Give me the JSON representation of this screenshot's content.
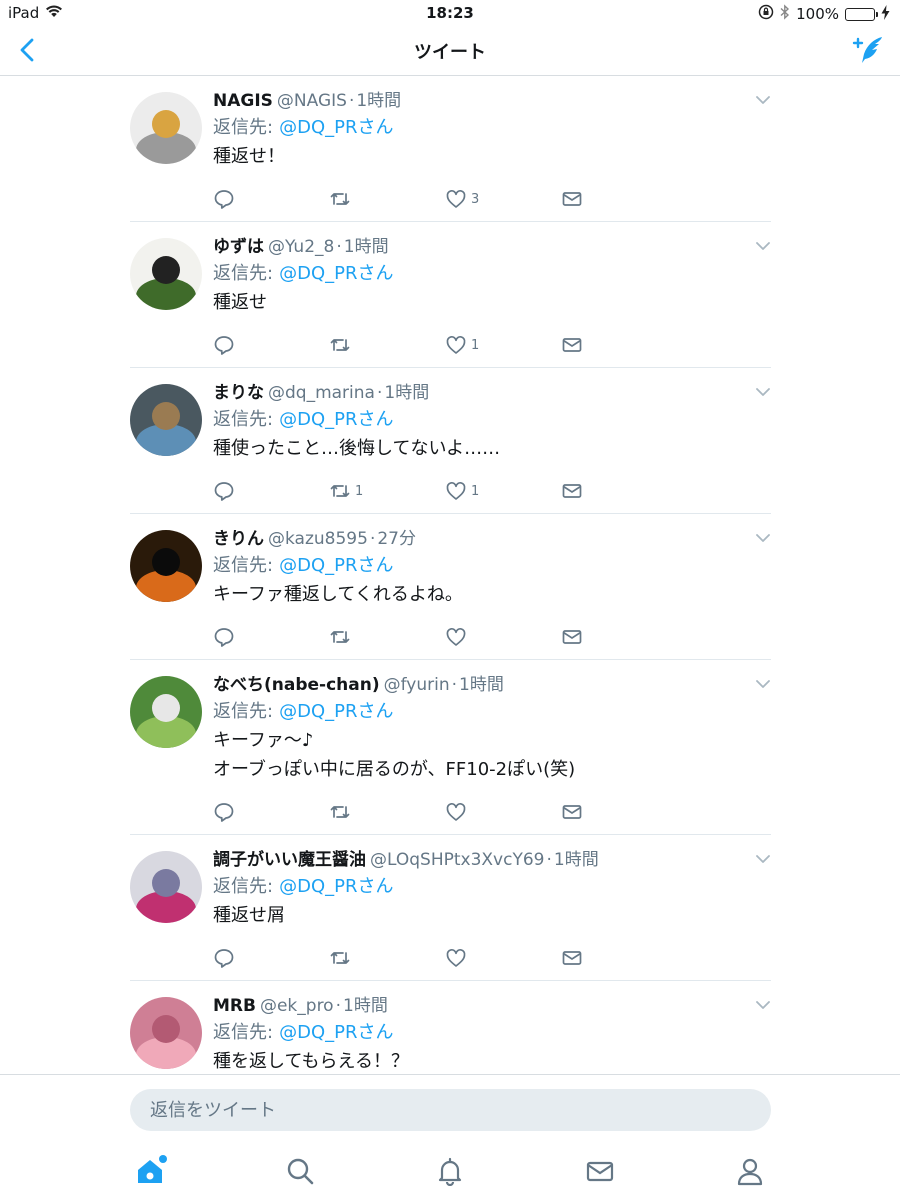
{
  "status_bar": {
    "device": "iPad",
    "time": "18:23",
    "battery": "100%",
    "battery_level": 1.0
  },
  "nav": {
    "title": "ツイート",
    "back_icon": "chevron-left-icon",
    "compose_icon": "compose-tweet-icon"
  },
  "colors": {
    "accent": "#1da1f2",
    "secondary_text": "#657786",
    "divider": "#e1e8ed",
    "input_bg": "#e6ecf0"
  },
  "tweets": [
    {
      "name": "NAGIS",
      "handle": "@NAGIS",
      "dot": "·",
      "time": "1時間",
      "reply_label": "返信先:",
      "reply_mention": "@DQ_PRさん",
      "text": "種返せ！",
      "retweets": "",
      "likes": "3"
    },
    {
      "name": "ゆずは",
      "handle": "@Yu2_8",
      "dot": "·",
      "time": "1時間",
      "reply_label": "返信先:",
      "reply_mention": "@DQ_PRさん",
      "text": "種返せ",
      "retweets": "",
      "likes": "1"
    },
    {
      "name": "まりな",
      "handle": "@dq_marina",
      "dot": "·",
      "time": "1時間",
      "reply_label": "返信先:",
      "reply_mention": "@DQ_PRさん",
      "text": "種使ったこと…後悔してないよ……",
      "retweets": "1",
      "likes": "1"
    },
    {
      "name": "きりん",
      "handle": "@kazu8595",
      "dot": "·",
      "time": "27分",
      "reply_label": "返信先:",
      "reply_mention": "@DQ_PRさん",
      "text": "キーファ種返してくれるよね。",
      "retweets": "",
      "likes": ""
    },
    {
      "name": "なべち(nabe-chan)",
      "handle": "@fyurin",
      "dot": "·",
      "time": "1時間",
      "reply_label": "返信先:",
      "reply_mention": "@DQ_PRさん",
      "text": "キーファ～♪\nオーブっぽい中に居るのが、FF10-2ぽい(笑)",
      "retweets": "",
      "likes": ""
    },
    {
      "name": "調子がいい魔王醤油",
      "handle": "@LOqSHPtx3XvcY69",
      "dot": "·",
      "time": "1時間",
      "reply_label": "返信先:",
      "reply_mention": "@DQ_PRさん",
      "text": "種返せ屑",
      "retweets": "",
      "likes": ""
    },
    {
      "name": "MRB",
      "handle": "@ek_pro",
      "dot": "·",
      "time": "1時間",
      "reply_label": "返信先:",
      "reply_mention": "@DQ_PRさん",
      "text": "種を返してもらえる！？",
      "retweets": "",
      "likes": ""
    }
  ],
  "reply_box": {
    "placeholder": "返信をツイート"
  },
  "tab_bar": {
    "items": [
      "home-icon",
      "search-icon",
      "notifications-bell-icon",
      "messages-envelope-icon",
      "profile-icon"
    ],
    "active": "home-icon"
  }
}
